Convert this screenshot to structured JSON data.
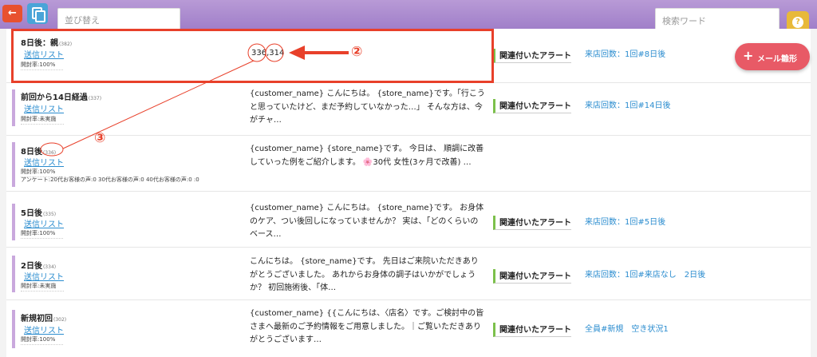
{
  "header": {
    "sort_placeholder": "並び替え",
    "search_placeholder": "検索ワード",
    "help_symbol": "?",
    "back_symbol": "←"
  },
  "mail_button": {
    "plus": "+",
    "label": "メール雛形"
  },
  "annotations": {
    "label_2": "②",
    "label_3": "③",
    "count_value": "336,314"
  },
  "rows": [
    {
      "title": "8日後：親",
      "id": "(382)",
      "send_list": "送信リスト",
      "meta": [
        "開封率:100%"
      ],
      "message": "",
      "alert_label": "関連付いたアラート",
      "alert_value": "来店回数：1回#8日後"
    },
    {
      "title": "前回から14日経過",
      "id": "(337)",
      "send_list": "送信リスト",
      "meta": [
        "開封率:未実施"
      ],
      "message": "{customer_name} こんにちは。 {store_name}です。「行こうと思っていたけど、まだ予約していなかった…」 そんな方は、今がチャ…",
      "alert_label": "関連付いたアラート",
      "alert_value": "来店回数：1回#14日後"
    },
    {
      "title": "8日後",
      "id": "(336)",
      "send_list": "送信リスト",
      "meta": [
        "開封率:100%",
        "アンケート:20代お客様の声:0 30代お客様の声:0 40代お客様の声:0 :0"
      ],
      "message": "{customer_name} {store_name}です。 今日は、 順調に改善していった例をご紹介します。 🌸30代 女性(3ヶ月で改善) …",
      "alert_label": "",
      "alert_value": ""
    },
    {
      "title": "5日後",
      "id": "(335)",
      "send_list": "送信リスト",
      "meta": [
        "開封率:100%"
      ],
      "message": "{customer_name} こんにちは。 {store_name}です。 お身体のケア、つい後回しになっていませんか？ 実は、「どのくらいのベース…",
      "alert_label": "関連付いたアラート",
      "alert_value": "来店回数：1回#5日後"
    },
    {
      "title": "2日後",
      "id": "(334)",
      "send_list": "送信リスト",
      "meta": [
        "開封率:未実施"
      ],
      "message": "こんにちは。 {store_name}です。 先日はご来院いただきありがとうございました。 あれからお身体の調子はいかがでしょうか？ 初回施術後、「体…",
      "alert_label": "関連付いたアラート",
      "alert_value": "来店回数：1回#来店なし　2日後"
    },
    {
      "title": "新規初回",
      "id": "(302)",
      "send_list": "送信リスト",
      "meta": [
        "開封率:100%"
      ],
      "message": "{customer_name} {{こんにちは、〈店名〉です。ご検討中の皆さまへ最新のご予約情報をご用意しました。｜ご覧いただきありがとうございます…",
      "alert_label": "関連付いたアラート",
      "alert_value": "全員#新規　空き状況1"
    }
  ]
}
